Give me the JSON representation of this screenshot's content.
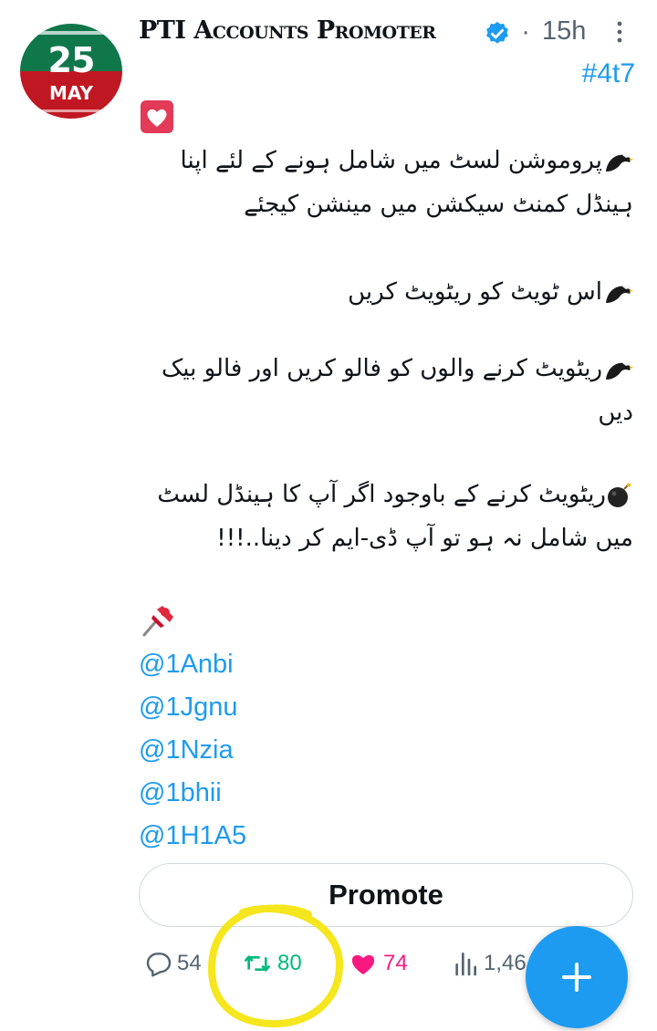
{
  "header": {
    "display_name": "PTI Accounts Promoter",
    "time": "15h",
    "tag": "#4t7"
  },
  "avatar": {
    "number": "25",
    "month": "MAY"
  },
  "body": {
    "lines": [
      "پروموشن لسٹ میں شامل ہونے کے لئے اپنا ہینڈل کمنٹ سیکشن میں مینشن کیجئے",
      "اس ٹویٹ کو ریٹویٹ کریں",
      "ریٹویٹ کرنے والوں کو فالو کریں اور فالو بیک دیں",
      "ریٹویٹ کرنے کے باوجود اگر آپ کا ہینڈل لسٹ میں شامل نہ ہو تو آپ ڈی-ایم کر دینا..!!!"
    ],
    "mentions": [
      "@1Anbi",
      "@1Jgnu",
      "@1Nzia",
      "@1bhii",
      "@1H1A5"
    ]
  },
  "promote_label": "Promote",
  "actions": {
    "replies": "54",
    "retweets": "80",
    "likes": "74",
    "views": "1,46"
  },
  "colors": {
    "accent": "#1d9bf0",
    "retweet": "#00ba7c",
    "like": "#f91880",
    "highlight_circle": "#f5e61d"
  }
}
